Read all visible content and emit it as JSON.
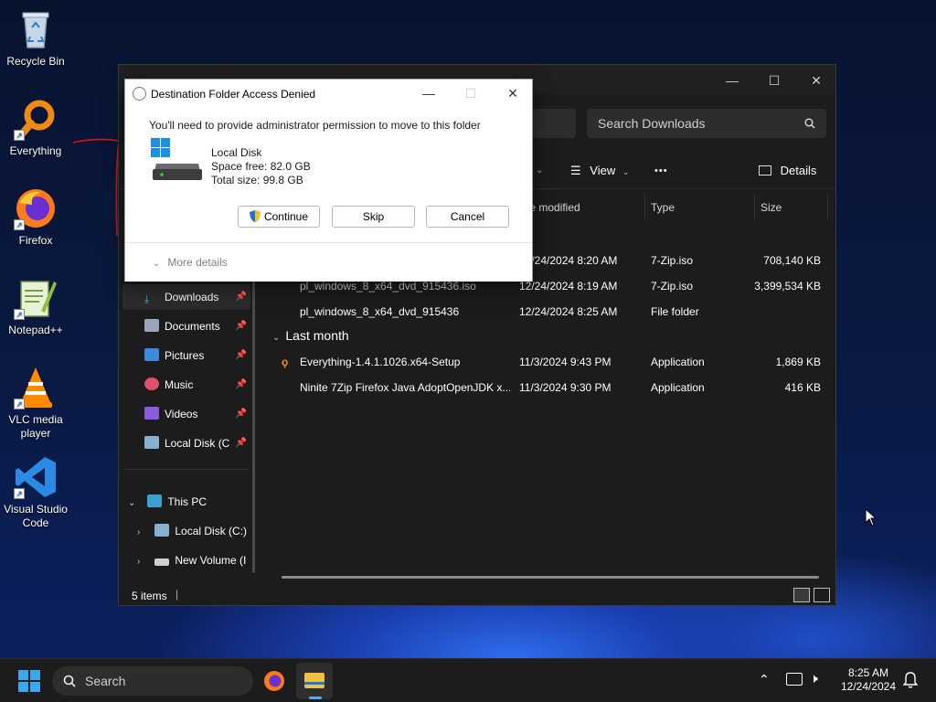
{
  "desktop": {
    "icons": [
      {
        "label": "Recycle Bin"
      },
      {
        "label": "Everything"
      },
      {
        "label": "Firefox"
      },
      {
        "label": "Notepad++"
      },
      {
        "label": "VLC media player"
      },
      {
        "label": "Visual Studio Code"
      }
    ]
  },
  "explorer": {
    "search_placeholder": "Search Downloads",
    "toolbar": {
      "view_label": "View",
      "more_label": "•••",
      "details_label": "Details"
    },
    "columns": [
      "te modified",
      "Type",
      "Size"
    ],
    "sidebar": [
      {
        "label": "Downloads",
        "pinned": true
      },
      {
        "label": "Documents",
        "pinned": true
      },
      {
        "label": "Pictures",
        "pinned": true
      },
      {
        "label": "Music",
        "pinned": true
      },
      {
        "label": "Videos",
        "pinned": true
      },
      {
        "label": "Local Disk (C",
        "pinned": true
      },
      {
        "label": "This PC"
      },
      {
        "label": "Local Disk (C:)"
      },
      {
        "label": "New Volume (I"
      }
    ],
    "rows_partial": [
      {
        "date": "12/24/2024 8:20 AM",
        "type": "7-Zip.iso",
        "size": "708,140 KB"
      },
      {
        "name": "pl_windows_8_x64_dvd_915436.iso",
        "date": "12/24/2024 8:19 AM",
        "type": "7-Zip.iso",
        "size": "3,399,534 KB"
      },
      {
        "name": "pl_windows_8_x64_dvd_915436",
        "date": "12/24/2024 8:25 AM",
        "type": "File folder",
        "size": ""
      }
    ],
    "group_last_month": "Last month",
    "rows_last_month": [
      {
        "name": "Everything-1.4.1.1026.x64-Setup",
        "date": "11/3/2024 9:43 PM",
        "type": "Application",
        "size": "1,869 KB"
      },
      {
        "name": "Ninite 7Zip Firefox Java AdoptOpenJDK x...",
        "date": "11/3/2024 9:30 PM",
        "type": "Application",
        "size": "416 KB"
      }
    ],
    "status": "5 items"
  },
  "dialog": {
    "title": "Destination Folder Access Denied",
    "message": "You'll need to provide administrator permission to move to this folder",
    "disk_name": "Local Disk",
    "space_free": "Space free: 82.0 GB",
    "total_size": "Total size: 99.8 GB",
    "buttons": {
      "continue": "Continue",
      "skip": "Skip",
      "cancel": "Cancel"
    },
    "more_details": "More details"
  },
  "taskbar": {
    "search_label": "Search",
    "time": "8:25 AM",
    "date": "12/24/2024"
  },
  "colors": {
    "accent": "#0078d4",
    "folder": "#e8b446",
    "uac_shield": "#1f6fd6"
  }
}
